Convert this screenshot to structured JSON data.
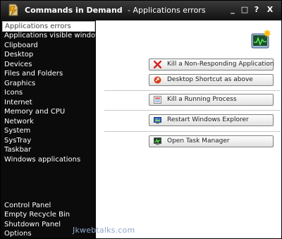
{
  "window": {
    "title_app": "Commands in Demand",
    "title_separator": "-",
    "title_section": "Applications errors",
    "controls": [
      "_",
      "□",
      "?",
      "X"
    ]
  },
  "sidebar": {
    "items": [
      "Applications errors",
      "Applications visible windows",
      "Clipboard",
      "Desktop",
      "Devices",
      "Files and Folders",
      "Graphics",
      "Icons",
      "Internet",
      "Memory and CPU",
      "Network",
      "System",
      "SysTray",
      "Taskbar",
      "Windows applications"
    ],
    "active_index": 0,
    "bottom_items": [
      "Control Panel",
      "Empty Recycle Bin",
      "Shutdown Panel",
      "Options"
    ]
  },
  "content": {
    "buttons": [
      {
        "label": "Kill a Non-Responding Application",
        "icon": "red-x-icon"
      },
      {
        "label": "Desktop Shortcut as above",
        "icon": "shortcut-icon"
      },
      {
        "label": "Kill a Running Process",
        "icon": "process-icon"
      },
      {
        "label": "Restart Windows Explorer",
        "icon": "explorer-icon"
      },
      {
        "label": "Open Task Manager",
        "icon": "task-manager-icon"
      }
    ]
  },
  "watermark": "Jkwebtalks.com"
}
